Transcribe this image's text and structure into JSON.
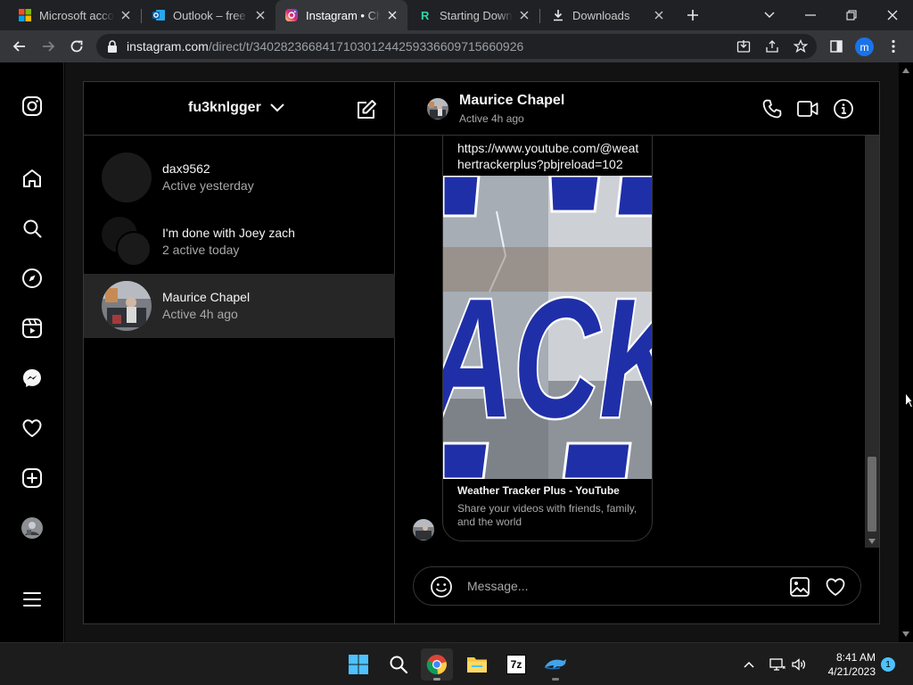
{
  "browser": {
    "tabs": [
      {
        "title": "Microsoft account",
        "active": false
      },
      {
        "title": "Outlook – free personal email",
        "active": false
      },
      {
        "title": "Instagram • Chats",
        "active": true
      },
      {
        "title": "Starting Download",
        "active": false
      },
      {
        "title": "Downloads",
        "active": false
      }
    ],
    "address": {
      "host": "instagram.com",
      "path": "/direct/t/340282366841710301244259336609715660926"
    },
    "profile_initial": "m"
  },
  "instagram": {
    "account_name": "fu3knlgger",
    "threads": [
      {
        "name": "dax9562",
        "status": "Active yesterday",
        "selected": false
      },
      {
        "name": "I'm done with Joey zach",
        "status": "2 active today",
        "selected": false
      },
      {
        "name": "Maurice Chapel",
        "status": "Active 4h ago",
        "selected": true
      }
    ],
    "chat": {
      "name": "Maurice Chapel",
      "status": "Active 4h ago",
      "message_url": "https://www.youtube.com/@weathertrackerplus?pbjreload=102",
      "link_title": "Weather Tracker Plus - YouTube",
      "link_description": "Share your videos with friends, family, and the world",
      "thumbnail_text": "ACK",
      "composer_placeholder": "Message..."
    }
  },
  "taskbar": {
    "time": "8:41 AM",
    "date": "4/21/2023",
    "notification_count": "1",
    "archive_label": "7z"
  },
  "colors": {
    "chrome_dark": "#202124",
    "chrome_toolbar": "#35363a",
    "ig_bg": "#000000",
    "ig_border": "#363636",
    "ig_selected": "#262626",
    "thumb_blue": "#1f2fa8"
  }
}
